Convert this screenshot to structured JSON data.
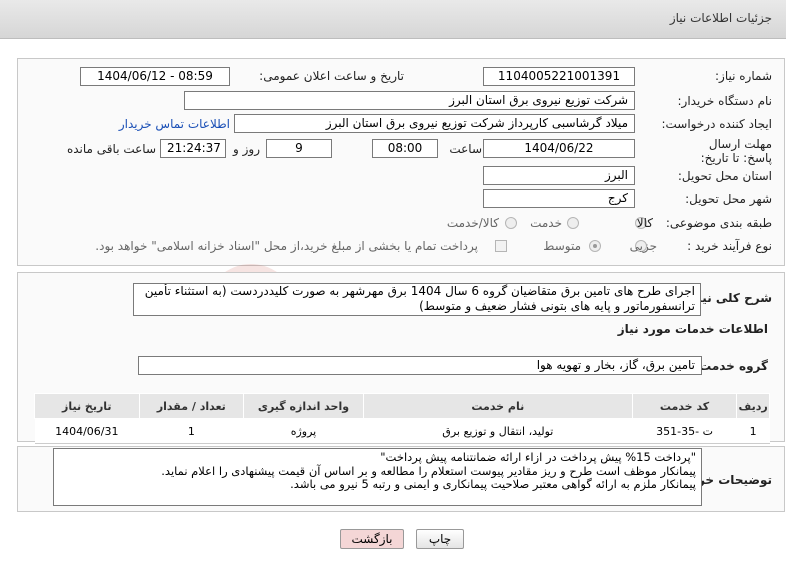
{
  "header": {
    "title": "جزئیات اطلاعات نیاز"
  },
  "form": {
    "need_number_label": "شماره نیاز:",
    "need_number": "1104005221001391",
    "announce_label": "تاریخ و ساعت اعلان عمومی:",
    "announce_value": "1404/06/12 - 08:59",
    "buyer_label": "نام دستگاه خریدار:",
    "buyer_value": "شرکت توزیع نیروی برق استان البرز",
    "creator_label": "ایجاد کننده درخواست:",
    "creator_value": "میلاد گرشاسبی کارپرداز شرکت توزیع نیروی برق استان البرز",
    "contact_link": "اطلاعات تماس خریدار",
    "deadline_label": "مهلت ارسال پاسخ: تا تاریخ:",
    "deadline_date": "1404/06/22",
    "time_label": "ساعت",
    "deadline_time": "08:00",
    "days_value": "9",
    "days_label": "روز و",
    "remaining_time": "21:24:37",
    "remaining_label": "ساعت باقی مانده",
    "province_label": "استان محل تحویل:",
    "province_value": "البرز",
    "city_label": "شهر محل تحویل:",
    "city_value": "کرج",
    "category_label": "طبقه بندی موضوعی:",
    "category_options": [
      "کالا",
      "خدمت",
      "کالا/خدمت"
    ],
    "process_label": "نوع فرآیند خرید :",
    "process_options": [
      "جزیی",
      "متوسط"
    ],
    "payment_note": "پرداخت تمام یا بخشی از مبلغ خرید،از محل \"اسناد خزانه اسلامی\" خواهد بود."
  },
  "description": {
    "label": "شرح کلی نیاز:",
    "text": "اجرای طرح های تامین برق متقاضیان گروه 6  سال 1404 برق مهرشهر به صورت کلیددردست (به استثناء تأمین ترانسفورماتور و پایه های بتونی فشار ضعیف و متوسط)"
  },
  "services": {
    "section_title": "اطلاعات خدمات مورد نیاز",
    "group_label": "گروه خدمت:",
    "group_value": "تامین برق، گاز، بخار و تهویه هوا",
    "columns": [
      "ردیف",
      "کد خدمت",
      "نام خدمت",
      "واحد اندازه گیری",
      "تعداد / مقدار",
      "تاریخ نیاز"
    ],
    "rows": [
      [
        "1",
        "ت -35-351",
        "تولید، انتقال و توزیع برق",
        "پروژه",
        "1",
        "1404/06/31"
      ]
    ]
  },
  "buyer_notes": {
    "label": "توضیحات خریدار:",
    "lines": [
      "\"پرداخت 15% پیش پرداخت در ازاء ارائه ضمانتنامه پیش پرداخت\"",
      "پیمانکار موظف است طرح و ریز مقادیر پیوست استعلام را مطالعه و بر اساس آن قیمت پیشنهادی را اعلام نماید.",
      "پیمانکار ملزم به ارائه گواهی معتبر صلاحیت پیمانکاری و ایمنی و رتبه 5 نیرو می باشد."
    ]
  },
  "buttons": {
    "print": "چاپ",
    "back": "بازگشت"
  },
  "colors": {
    "link": "#1a4fb6",
    "back_button_bg": "#f4d6d6"
  }
}
